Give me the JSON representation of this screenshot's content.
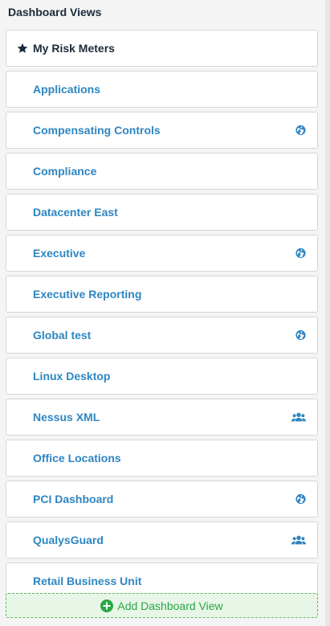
{
  "panel": {
    "title": "Dashboard Views",
    "favorite": {
      "label": "My Risk Meters",
      "icon": "star-icon"
    },
    "items": [
      {
        "label": "Applications",
        "badge": ""
      },
      {
        "label": "Compensating Controls",
        "badge": "globe"
      },
      {
        "label": "Compliance",
        "badge": ""
      },
      {
        "label": "Datacenter East",
        "badge": ""
      },
      {
        "label": "Executive",
        "badge": "globe"
      },
      {
        "label": "Executive Reporting",
        "badge": ""
      },
      {
        "label": "Global test",
        "badge": "globe"
      },
      {
        "label": "Linux Desktop",
        "badge": ""
      },
      {
        "label": "Nessus XML",
        "badge": "users"
      },
      {
        "label": "Office Locations",
        "badge": ""
      },
      {
        "label": "PCI Dashboard",
        "badge": "globe"
      },
      {
        "label": "QualysGuard",
        "badge": "users"
      },
      {
        "label": "Retail Business Unit",
        "badge": ""
      }
    ],
    "add_button": {
      "label": "Add Dashboard View",
      "icon": "plus-circle-icon"
    }
  },
  "colors": {
    "link": "#2e86c1",
    "title": "#1b2a3a",
    "add_green": "#28a745"
  }
}
